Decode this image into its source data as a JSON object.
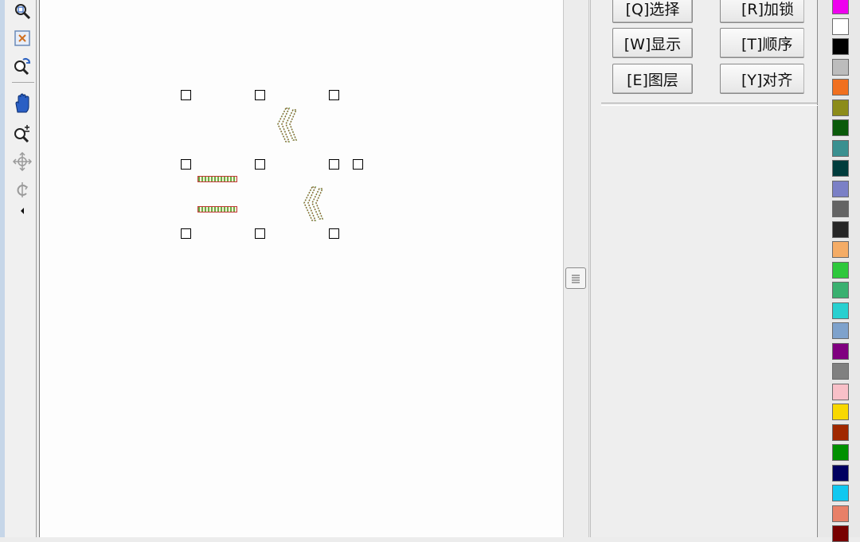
{
  "toolbar": {
    "tools": [
      {
        "name": "zoom-window-icon"
      },
      {
        "name": "zoom-fit-icon"
      },
      {
        "name": "zoom-previous-icon"
      },
      {
        "name": "pan-hand-icon"
      },
      {
        "name": "zoom-in-out-icon"
      },
      {
        "name": "move-view-icon"
      },
      {
        "name": "rotate-view-icon"
      },
      {
        "name": "scroll-left-arrow-icon"
      }
    ]
  },
  "canvas": {
    "objects": [
      {
        "name": "double-chevron-shape",
        "glyph": "《"
      },
      {
        "name": "double-bar-shape",
        "glyph": "="
      },
      {
        "name": "double-chevron-shape",
        "glyph": "《"
      }
    ]
  },
  "panel": {
    "buttons": [
      {
        "key": "Q",
        "label": "选择"
      },
      {
        "key": "R",
        "label": "加锁"
      },
      {
        "key": "W",
        "label": "显示"
      },
      {
        "key": "T",
        "label": "顺序"
      },
      {
        "key": "E",
        "label": "图层"
      },
      {
        "key": "Y",
        "label": "对齐"
      }
    ],
    "buttons_text": {
      "select": "[Q]选择",
      "lock": "[R]加锁",
      "show": "[W]显示",
      "order": "[T]顺序",
      "layer": "[E]图层",
      "align": "[Y]对齐"
    }
  },
  "palette": {
    "colors": [
      "#ee00ee",
      "#ffffff",
      "#000000",
      "#bcbcbc",
      "#f07020",
      "#8c8c1a",
      "#0a5a0a",
      "#3a9090",
      "#003c3c",
      "#7b80c6",
      "#646464",
      "#262626",
      "#f4ac66",
      "#2ec83c",
      "#3ab070",
      "#28d0d0",
      "#7ea2cc",
      "#800080",
      "#808080",
      "#f8c0c8",
      "#f8d800",
      "#a02800",
      "#009000",
      "#000060",
      "#10c8f0",
      "#e88068",
      "#780000"
    ]
  },
  "colors": {
    "chevron_green": "#5aa040",
    "chevron_red": "#c43a3a",
    "toolbar_border": "#c6d6e8"
  }
}
